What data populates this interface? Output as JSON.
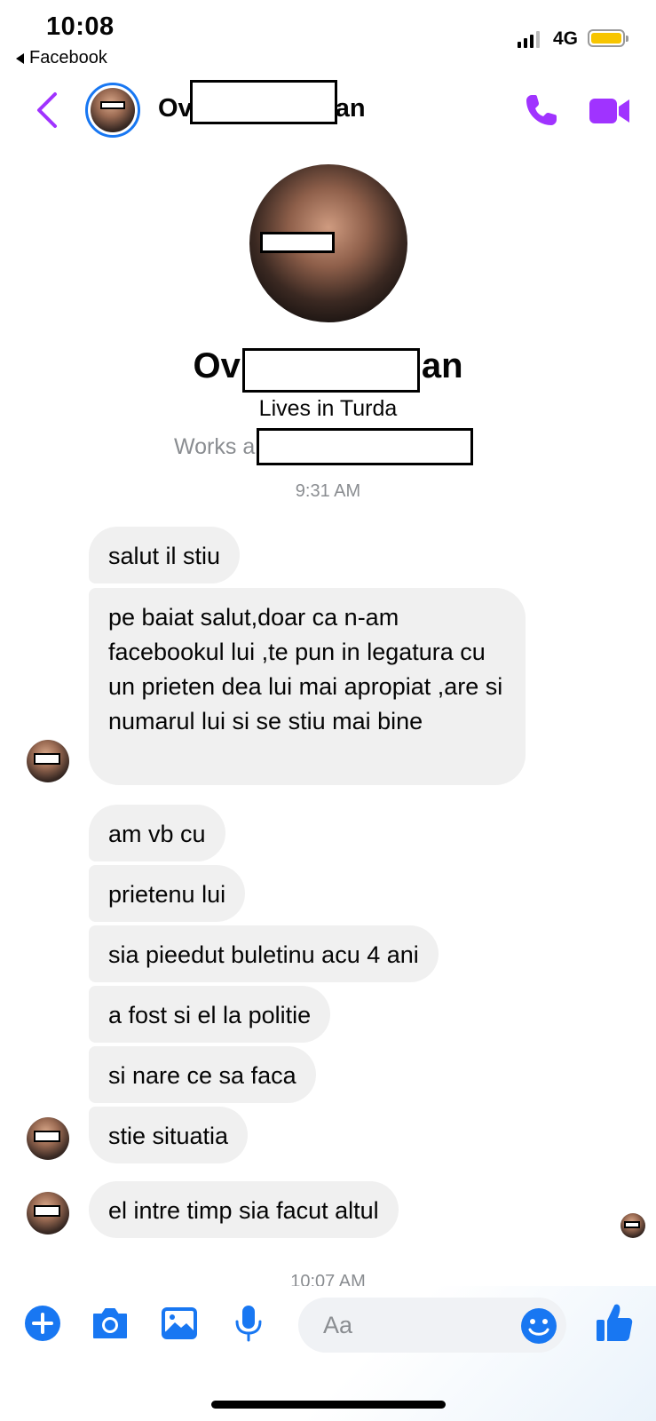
{
  "status_bar": {
    "time": "10:08",
    "back_app": "Facebook",
    "network": "4G"
  },
  "header": {
    "name_prefix": "Ov",
    "name_suffix": "an"
  },
  "profile": {
    "name_prefix": "Ov",
    "name_suffix": "an",
    "lives": "Lives in Turda",
    "works_prefix": "Works a"
  },
  "thread": {
    "timestamp_1": "9:31 AM",
    "messages": [
      "salut il stiu",
      "pe baiat salut,doar ca n-am facebookul lui ,te pun in legatura cu un prieten dea lui mai apropiat ,are si numarul lui si se stiu mai bine",
      "am vb cu",
      "prietenu lui",
      "sia pieedut buletinu acu 4 ani",
      "a fost si el la politie",
      "si nare ce sa faca",
      "stie situatia",
      "el intre timp sia facut  altul"
    ],
    "timestamp_2": "10:07 AM"
  },
  "composer": {
    "placeholder": "Aa"
  },
  "colors": {
    "accent": "#1877f2",
    "header_icons": "#a033ff",
    "bubble": "#f0f0f0"
  }
}
